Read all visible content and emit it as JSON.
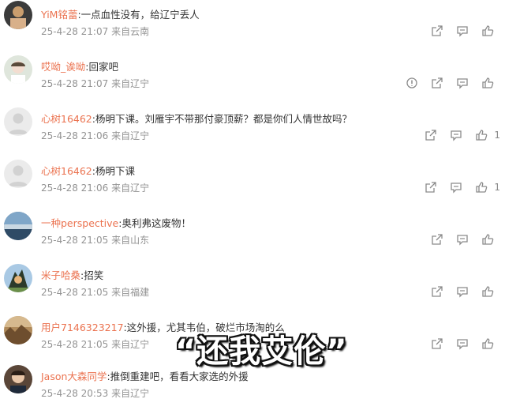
{
  "comments": [
    {
      "user": "YiM铭蕾",
      "text": ":一点血性没有，给辽宁丢人",
      "time": "25-4-28 21:07",
      "location": "来自云南",
      "likes": ""
    },
    {
      "user": "哎呦_诶呦",
      "text": ":回家吧",
      "time": "25-4-28 21:07",
      "location": "来自辽宁",
      "likes": ""
    },
    {
      "user": "心树16462",
      "text": ":杨明下课。刘雁宇不带那付豪顶薪？都是你们人情世故吗？",
      "time": "25-4-28 21:06",
      "location": "来自辽宁",
      "likes": "1"
    },
    {
      "user": "心树16462",
      "text": ":杨明下课",
      "time": "25-4-28 21:06",
      "location": "来自辽宁",
      "likes": "1"
    },
    {
      "user": "一种perspective",
      "text": ":奥利弗这废物！",
      "time": "25-4-28 21:05",
      "location": "来自山东",
      "likes": ""
    },
    {
      "user": "米子哈桑",
      "text": ":招笑",
      "time": "25-4-28 21:05",
      "location": "来自福建",
      "likes": ""
    },
    {
      "user": "用户7146323217",
      "text": ":这外援，尤其韦伯，破烂市场淘的么",
      "time": "25-4-28 21:05",
      "location": "来自辽宁",
      "likes": ""
    },
    {
      "user": "Jason大森同学",
      "text": ":推倒重建吧，看看大家选的外援",
      "time": "25-4-28 20:53",
      "location": "来自辽宁",
      "likes": ""
    }
  ],
  "subtitle": "“还我艾伦”",
  "colors": {
    "username": "#eb7350",
    "meta": "#939393",
    "icon": "#8a8a8a"
  }
}
